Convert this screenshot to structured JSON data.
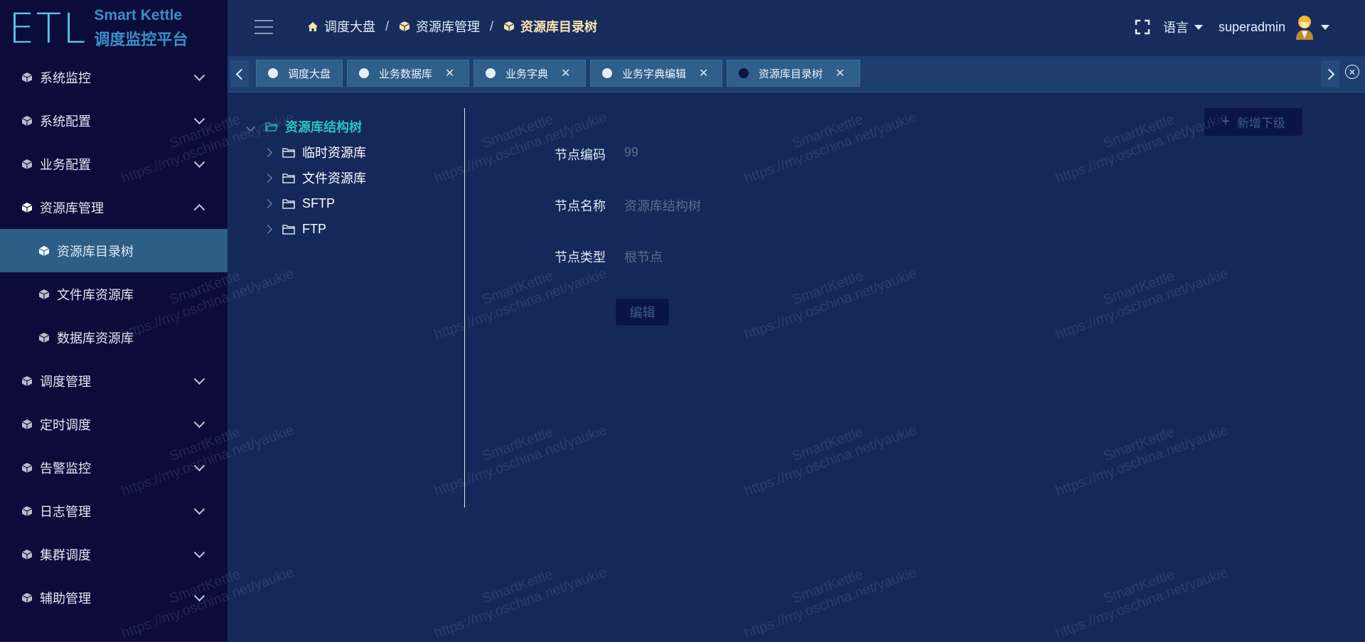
{
  "app": {
    "logo_mark": "ETL",
    "name": "Smart Kettle",
    "subtitle": "调度监控平台"
  },
  "sidebar": {
    "items": [
      {
        "label": "系统监控",
        "expanded": false
      },
      {
        "label": "系统配置",
        "expanded": false
      },
      {
        "label": "业务配置",
        "expanded": false
      },
      {
        "label": "资源库管理",
        "expanded": true
      },
      {
        "label": "资源库目录树",
        "sub": true,
        "active": true
      },
      {
        "label": "文件库资源库",
        "sub": true
      },
      {
        "label": "数据库资源库",
        "sub": true
      },
      {
        "label": "调度管理",
        "expanded": false
      },
      {
        "label": "定时调度",
        "expanded": false
      },
      {
        "label": "告警监控",
        "expanded": false
      },
      {
        "label": "日志管理",
        "expanded": false
      },
      {
        "label": "集群调度",
        "expanded": false
      },
      {
        "label": "辅助管理",
        "expanded": false
      }
    ]
  },
  "breadcrumb": {
    "home": "调度大盘",
    "section": "资源库管理",
    "current": "资源库目录树",
    "separator": "/"
  },
  "header": {
    "language": "语言",
    "username": "superadmin"
  },
  "tabs": [
    {
      "label": "调度大盘",
      "closable": false,
      "active": false
    },
    {
      "label": "业务数据库",
      "closable": true,
      "active": false
    },
    {
      "label": "业务字典",
      "closable": true,
      "active": false
    },
    {
      "label": "业务字典编辑",
      "closable": true,
      "active": false
    },
    {
      "label": "资源库目录树",
      "closable": true,
      "active": true
    }
  ],
  "tabs_close_symbol": "✕",
  "tree": {
    "root": "资源库结构树",
    "children": [
      "临时资源库",
      "文件资源库",
      "SFTP",
      "FTP"
    ]
  },
  "form": {
    "code_label": "节点编码",
    "code_value": "99",
    "name_label": "节点名称",
    "name_value": "资源库结构树",
    "type_label": "节点类型",
    "type_value": "根节点"
  },
  "buttons": {
    "edit": "编辑",
    "add_child": "新增下级",
    "add_child_icon": "+"
  },
  "watermark": {
    "line1": "SmartKettle",
    "line2": "https://my.oschina.net/yaukie"
  },
  "colors": {
    "sidebar_bg": "#0b0c3a",
    "content_bg": "#14295a",
    "active_menu": "#2c5e86",
    "tree_root": "#2ec0c0",
    "breadcrumb_current": "#fde2b0"
  }
}
